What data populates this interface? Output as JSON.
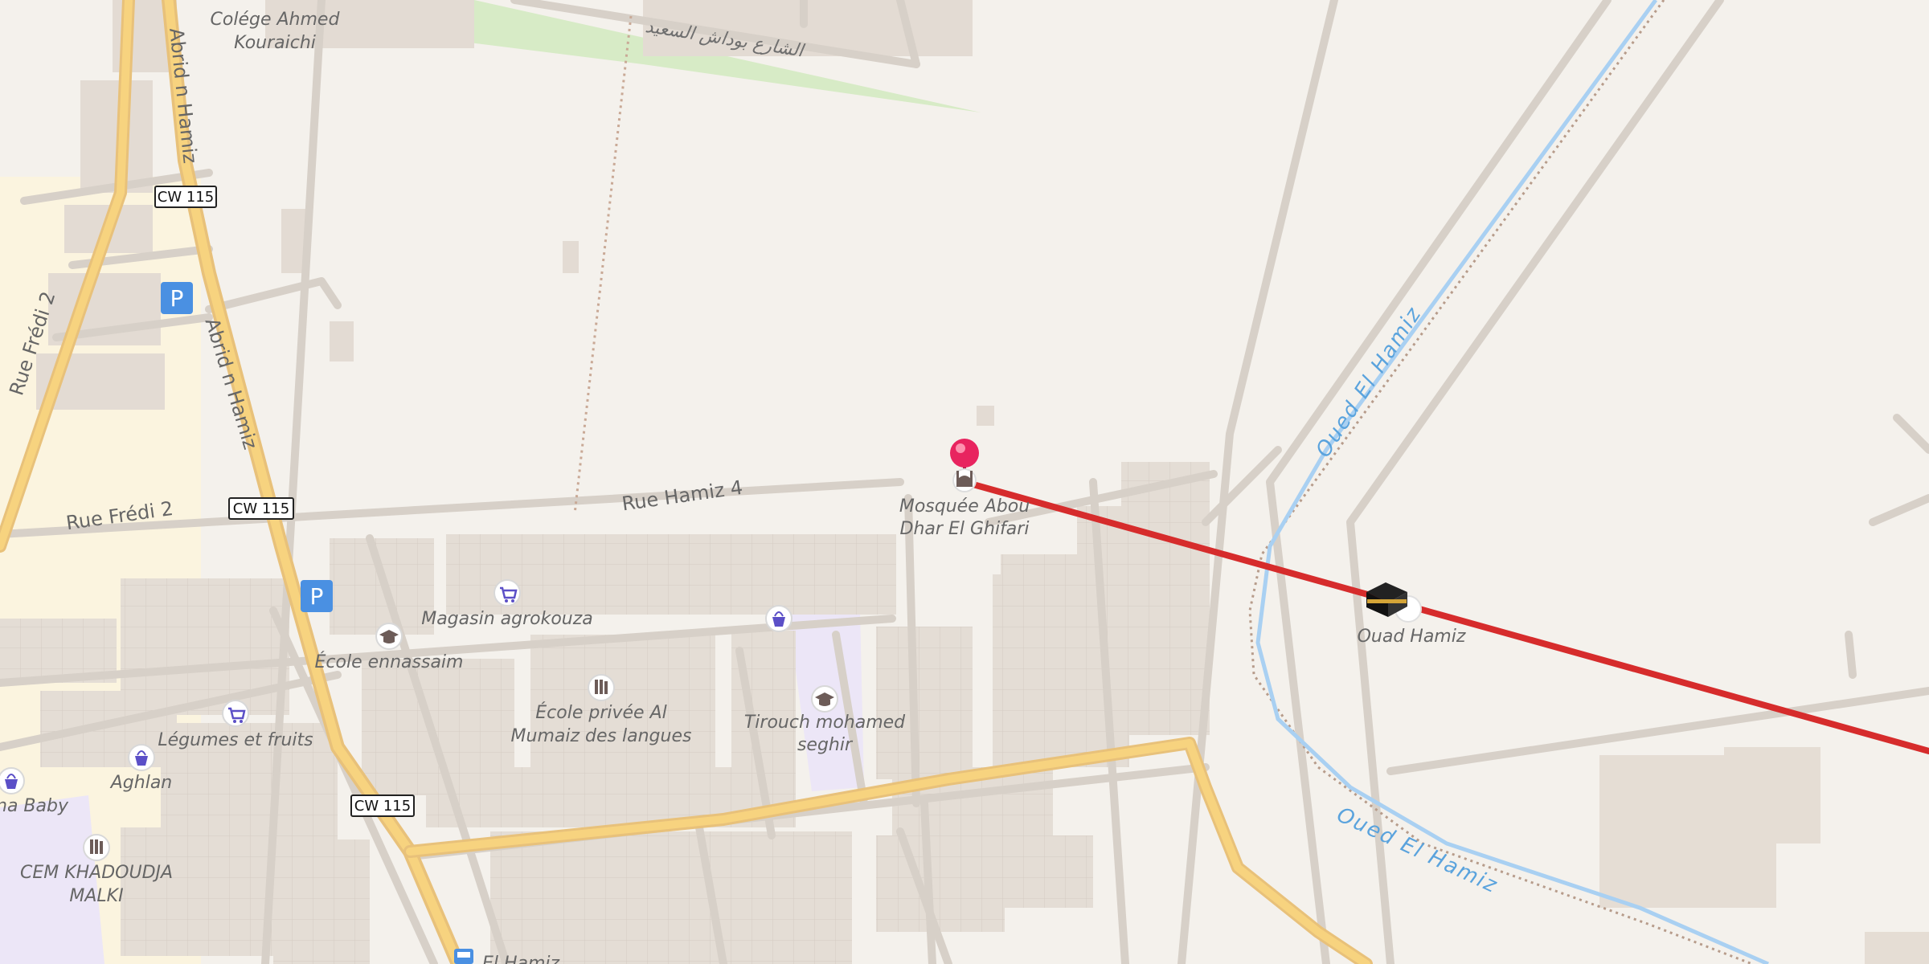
{
  "map": {
    "labels": {
      "college": "Colége Ahmed Kouraichi",
      "college_line1": "Colége Ahmed",
      "college_line2": "Kouraichi",
      "arabic_street": "الشارع بوداش السعيد",
      "abrid_top": "Abrid n Hamiz",
      "abrid_mid": "Abrid n Hamiz",
      "rue_fredi_vertical": "Rue Frédi 2",
      "rue_fredi_horizontal": "Rue Frédi 2",
      "rue_hamiz": "Rue Hamiz 4",
      "mosque_line1": "Mosquée Abou",
      "mosque_line2": "Dhar El Ghifari",
      "magasin": "Magasin agrokouza",
      "ecole_ennassaim": "École ennassaim",
      "ecole_privee_line1": "École privée Al",
      "ecole_privee_line2": "Mumaiz des langues",
      "tirouch_line1": "Tirouch mohamed",
      "tirouch_line2": "seghir",
      "legumes": "Légumes et fruits",
      "aghlan": "Aghlan",
      "baby": "na Baby",
      "cem_line1": "CEM KHADOUDJA",
      "cem_line2": "MALKI",
      "el_hamiz": "El Hamiz",
      "ouad_hamiz": "Ouad Hamiz",
      "oued_upper": "Oued El Hamiz",
      "oued_lower": "Oued El Hamiz"
    },
    "road_shields": [
      "CW 115",
      "CW 115",
      "CW 115"
    ],
    "parking_symbol": "P",
    "colors": {
      "route_line": "#d62c2c",
      "marker_pin": "#e8245f",
      "primary_road": "#f7d37f",
      "water": "#a9d0f2",
      "park": "#d7ebc6",
      "building": "#e2dad2",
      "school_area": "#ece6f7"
    },
    "icons": {
      "pin": "location-pin-icon",
      "mosque": "mosque-icon",
      "kaaba": "kaaba-icon",
      "shop": "shopping-cart-icon",
      "bag": "shopping-bag-icon",
      "school": "school-icon",
      "library": "books-icon",
      "parking": "parking-icon",
      "bus": "bus-stop-icon"
    }
  }
}
